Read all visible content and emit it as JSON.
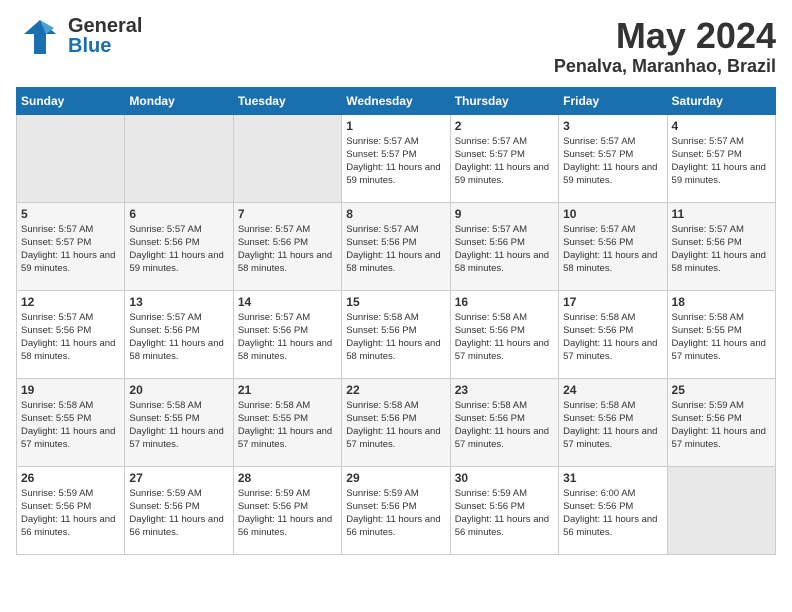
{
  "header": {
    "logo_general": "General",
    "logo_blue": "Blue",
    "month": "May 2024",
    "location": "Penalva, Maranhao, Brazil"
  },
  "days_of_week": [
    "Sunday",
    "Monday",
    "Tuesday",
    "Wednesday",
    "Thursday",
    "Friday",
    "Saturday"
  ],
  "weeks": [
    [
      {
        "day": "",
        "sunrise": "",
        "sunset": "",
        "daylight": ""
      },
      {
        "day": "",
        "sunrise": "",
        "sunset": "",
        "daylight": ""
      },
      {
        "day": "",
        "sunrise": "",
        "sunset": "",
        "daylight": ""
      },
      {
        "day": "1",
        "sunrise": "Sunrise: 5:57 AM",
        "sunset": "Sunset: 5:57 PM",
        "daylight": "Daylight: 11 hours and 59 minutes."
      },
      {
        "day": "2",
        "sunrise": "Sunrise: 5:57 AM",
        "sunset": "Sunset: 5:57 PM",
        "daylight": "Daylight: 11 hours and 59 minutes."
      },
      {
        "day": "3",
        "sunrise": "Sunrise: 5:57 AM",
        "sunset": "Sunset: 5:57 PM",
        "daylight": "Daylight: 11 hours and 59 minutes."
      },
      {
        "day": "4",
        "sunrise": "Sunrise: 5:57 AM",
        "sunset": "Sunset: 5:57 PM",
        "daylight": "Daylight: 11 hours and 59 minutes."
      }
    ],
    [
      {
        "day": "5",
        "sunrise": "Sunrise: 5:57 AM",
        "sunset": "Sunset: 5:57 PM",
        "daylight": "Daylight: 11 hours and 59 minutes."
      },
      {
        "day": "6",
        "sunrise": "Sunrise: 5:57 AM",
        "sunset": "Sunset: 5:56 PM",
        "daylight": "Daylight: 11 hours and 59 minutes."
      },
      {
        "day": "7",
        "sunrise": "Sunrise: 5:57 AM",
        "sunset": "Sunset: 5:56 PM",
        "daylight": "Daylight: 11 hours and 58 minutes."
      },
      {
        "day": "8",
        "sunrise": "Sunrise: 5:57 AM",
        "sunset": "Sunset: 5:56 PM",
        "daylight": "Daylight: 11 hours and 58 minutes."
      },
      {
        "day": "9",
        "sunrise": "Sunrise: 5:57 AM",
        "sunset": "Sunset: 5:56 PM",
        "daylight": "Daylight: 11 hours and 58 minutes."
      },
      {
        "day": "10",
        "sunrise": "Sunrise: 5:57 AM",
        "sunset": "Sunset: 5:56 PM",
        "daylight": "Daylight: 11 hours and 58 minutes."
      },
      {
        "day": "11",
        "sunrise": "Sunrise: 5:57 AM",
        "sunset": "Sunset: 5:56 PM",
        "daylight": "Daylight: 11 hours and 58 minutes."
      }
    ],
    [
      {
        "day": "12",
        "sunrise": "Sunrise: 5:57 AM",
        "sunset": "Sunset: 5:56 PM",
        "daylight": "Daylight: 11 hours and 58 minutes."
      },
      {
        "day": "13",
        "sunrise": "Sunrise: 5:57 AM",
        "sunset": "Sunset: 5:56 PM",
        "daylight": "Daylight: 11 hours and 58 minutes."
      },
      {
        "day": "14",
        "sunrise": "Sunrise: 5:57 AM",
        "sunset": "Sunset: 5:56 PM",
        "daylight": "Daylight: 11 hours and 58 minutes."
      },
      {
        "day": "15",
        "sunrise": "Sunrise: 5:58 AM",
        "sunset": "Sunset: 5:56 PM",
        "daylight": "Daylight: 11 hours and 58 minutes."
      },
      {
        "day": "16",
        "sunrise": "Sunrise: 5:58 AM",
        "sunset": "Sunset: 5:56 PM",
        "daylight": "Daylight: 11 hours and 57 minutes."
      },
      {
        "day": "17",
        "sunrise": "Sunrise: 5:58 AM",
        "sunset": "Sunset: 5:56 PM",
        "daylight": "Daylight: 11 hours and 57 minutes."
      },
      {
        "day": "18",
        "sunrise": "Sunrise: 5:58 AM",
        "sunset": "Sunset: 5:55 PM",
        "daylight": "Daylight: 11 hours and 57 minutes."
      }
    ],
    [
      {
        "day": "19",
        "sunrise": "Sunrise: 5:58 AM",
        "sunset": "Sunset: 5:55 PM",
        "daylight": "Daylight: 11 hours and 57 minutes."
      },
      {
        "day": "20",
        "sunrise": "Sunrise: 5:58 AM",
        "sunset": "Sunset: 5:55 PM",
        "daylight": "Daylight: 11 hours and 57 minutes."
      },
      {
        "day": "21",
        "sunrise": "Sunrise: 5:58 AM",
        "sunset": "Sunset: 5:55 PM",
        "daylight": "Daylight: 11 hours and 57 minutes."
      },
      {
        "day": "22",
        "sunrise": "Sunrise: 5:58 AM",
        "sunset": "Sunset: 5:56 PM",
        "daylight": "Daylight: 11 hours and 57 minutes."
      },
      {
        "day": "23",
        "sunrise": "Sunrise: 5:58 AM",
        "sunset": "Sunset: 5:56 PM",
        "daylight": "Daylight: 11 hours and 57 minutes."
      },
      {
        "day": "24",
        "sunrise": "Sunrise: 5:58 AM",
        "sunset": "Sunset: 5:56 PM",
        "daylight": "Daylight: 11 hours and 57 minutes."
      },
      {
        "day": "25",
        "sunrise": "Sunrise: 5:59 AM",
        "sunset": "Sunset: 5:56 PM",
        "daylight": "Daylight: 11 hours and 57 minutes."
      }
    ],
    [
      {
        "day": "26",
        "sunrise": "Sunrise: 5:59 AM",
        "sunset": "Sunset: 5:56 PM",
        "daylight": "Daylight: 11 hours and 56 minutes."
      },
      {
        "day": "27",
        "sunrise": "Sunrise: 5:59 AM",
        "sunset": "Sunset: 5:56 PM",
        "daylight": "Daylight: 11 hours and 56 minutes."
      },
      {
        "day": "28",
        "sunrise": "Sunrise: 5:59 AM",
        "sunset": "Sunset: 5:56 PM",
        "daylight": "Daylight: 11 hours and 56 minutes."
      },
      {
        "day": "29",
        "sunrise": "Sunrise: 5:59 AM",
        "sunset": "Sunset: 5:56 PM",
        "daylight": "Daylight: 11 hours and 56 minutes."
      },
      {
        "day": "30",
        "sunrise": "Sunrise: 5:59 AM",
        "sunset": "Sunset: 5:56 PM",
        "daylight": "Daylight: 11 hours and 56 minutes."
      },
      {
        "day": "31",
        "sunrise": "Sunrise: 6:00 AM",
        "sunset": "Sunset: 5:56 PM",
        "daylight": "Daylight: 11 hours and 56 minutes."
      },
      {
        "day": "",
        "sunrise": "",
        "sunset": "",
        "daylight": ""
      }
    ]
  ]
}
